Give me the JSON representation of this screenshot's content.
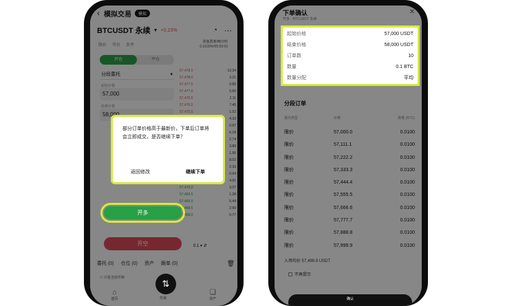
{
  "left": {
    "topbar": {
      "back_icon": "‹",
      "title": "模拟交易",
      "badge": "模拟"
    },
    "pair": {
      "name": "BTCUSDT 永续",
      "change": "+0.23%"
    },
    "tabs": [
      "限价",
      "市价",
      "条件"
    ],
    "fund": [
      "资金费率/倒计时",
      "0.0100%/05:59:59"
    ],
    "order_tabs": [
      "开仓",
      "平仓"
    ],
    "order_type": "分段委托",
    "inputs": [
      {
        "label": "起始价格",
        "value": "57,000"
      },
      {
        "label": "结束价格",
        "value": "58,000"
      }
    ],
    "orderbook": [
      {
        "price": "57,478.5",
        "qty": "12.34",
        "side": "ask"
      },
      {
        "price": "57,478.0",
        "qty": "3.21",
        "side": "ask"
      },
      {
        "price": "57,477.5",
        "qty": "0.85",
        "side": "ask"
      },
      {
        "price": "57,477.0",
        "qty": "5.60",
        "side": "ask"
      },
      {
        "price": "57,476.5",
        "qty": "2.11",
        "side": "ask"
      },
      {
        "price": "57,476.0",
        "qty": "7.45",
        "side": "ask"
      },
      {
        "price": "57,475.5",
        "qty": "1.02",
        "side": "ask"
      },
      {
        "price": "57,475.0",
        "qty": "4.33",
        "side": "ask"
      },
      {
        "price": "57,474.5",
        "qty": "0.97",
        "side": "ask"
      },
      {
        "price": "57,474.0",
        "qty": "6.18",
        "side": "ask"
      },
      {
        "price": "57,473.5",
        "qty": "2.74",
        "side": "ask"
      },
      {
        "price": "57,473.0",
        "qty": "3.89",
        "side": "ask"
      },
      {
        "price": "57,472.5",
        "qty": "1.56",
        "side": "bid"
      },
      {
        "price": "57,472.0",
        "qty": "8.02",
        "side": "bid"
      },
      {
        "price": "57,471.5",
        "qty": "2.33",
        "side": "bid"
      },
      {
        "price": "57,471.0",
        "qty": "0.64",
        "side": "bid"
      },
      {
        "price": "57,470.5",
        "qty": "4.91",
        "side": "bid"
      },
      {
        "price": "57,470.0",
        "qty": "3.07",
        "side": "bid"
      },
      {
        "price": "57,469.5",
        "qty": "1.28",
        "side": "bid"
      },
      {
        "price": "57,469.0",
        "qty": "5.44",
        "side": "bid"
      },
      {
        "price": "57,468.5",
        "qty": "2.90",
        "side": "bid"
      },
      {
        "price": "57,468.0",
        "qty": "0.77",
        "side": "bid"
      }
    ],
    "open_label": "开多",
    "close_label": "开空",
    "depth_value": "0.1",
    "bottom_tabs": [
      "委托 (0)",
      "仓位 (0)",
      "资产",
      "跟单 (0)"
    ],
    "show_current": "只看当前币种",
    "nav": [
      {
        "icon": "⌂",
        "label": "首页"
      },
      {
        "icon": "❏",
        "label": "资产"
      }
    ],
    "fab_icon": "⇅",
    "fab_label": "交易",
    "dialog": {
      "message": "部分订单价格高于最新价，下单后订单将会立即成交，是否继续下单？",
      "back": "返回修改",
      "continue": "继续下单"
    }
  },
  "right": {
    "title": "下单确认",
    "subtitle": "开多 · BTCUSDT 永续",
    "close_icon": "✕",
    "summary": [
      {
        "k": "起始价格",
        "v": "57,000 USDT"
      },
      {
        "k": "结束价格",
        "v": "58,000 USDT"
      },
      {
        "k": "订单数",
        "v": "10"
      },
      {
        "k": "数量",
        "v": "0.1 BTC"
      },
      {
        "k": "数量分配",
        "v": "平均"
      }
    ],
    "section_title": "分段订单",
    "head": [
      "委托类型",
      "价格",
      "数量 (BTC)"
    ],
    "rows": [
      [
        "限价",
        "57,000.0",
        "0.0100"
      ],
      [
        "限价",
        "57,111.1",
        "0.0100"
      ],
      [
        "限价",
        "57,222.2",
        "0.0100"
      ],
      [
        "限价",
        "57,333.3",
        "0.0100"
      ],
      [
        "限价",
        "57,444.4",
        "0.0100"
      ],
      [
        "限价",
        "57,555.5",
        "0.0100"
      ],
      [
        "限价",
        "57,666.6",
        "0.0100"
      ],
      [
        "限价",
        "57,777.7",
        "0.0100"
      ],
      [
        "限价",
        "57,888.8",
        "0.0100"
      ],
      [
        "限价",
        "57,999.9",
        "0.0100"
      ]
    ],
    "avg_price": "入场均价 57,499.9 USDT",
    "no_remind": "不再提示",
    "confirm": "确认"
  }
}
